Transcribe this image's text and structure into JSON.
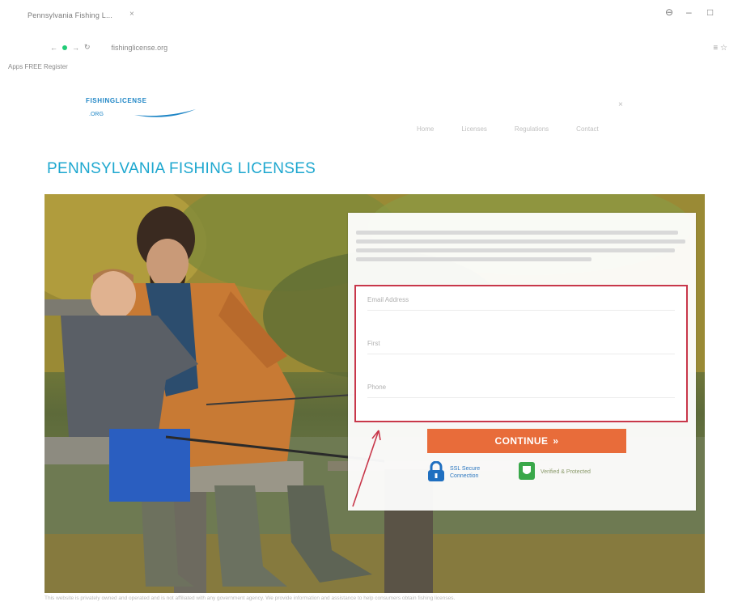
{
  "browser": {
    "tab_title": "Pennsylvania Fishing L...",
    "tab_close": "×",
    "url": "fishinglicense.org",
    "bookmark": "Apps   FREE Register",
    "window_controls": {
      "account": "⊖",
      "minimize": "–",
      "maximize": "□"
    },
    "extension_icon": "≡ ☆"
  },
  "site": {
    "logo_text": "FISHINGLICENSE",
    "logo_sub": ".ORG",
    "header_corner": "×",
    "nav": [
      "Home",
      "Licenses",
      "Regulations",
      "Contact"
    ]
  },
  "page": {
    "title": "PENNSYLVANIA FISHING LICENSES"
  },
  "form": {
    "fields": [
      {
        "placeholder": "Email Address"
      },
      {
        "placeholder": "First"
      },
      {
        "placeholder": "Phone"
      }
    ],
    "continue_label": "CONTINUE",
    "continue_arrows": "»",
    "secure_label": "SSL Secure",
    "secure_sub": "Connection",
    "verified_label": "Verified & Protected"
  },
  "footer": {
    "text": "This website is privately owned and operated and is not affiliated with any government agency. We provide information and assistance to help consumers obtain fishing licenses."
  },
  "colors": {
    "brand_blue": "#1da7cf",
    "accent_orange": "#e86c3a",
    "highlight_red": "#c8374a"
  }
}
